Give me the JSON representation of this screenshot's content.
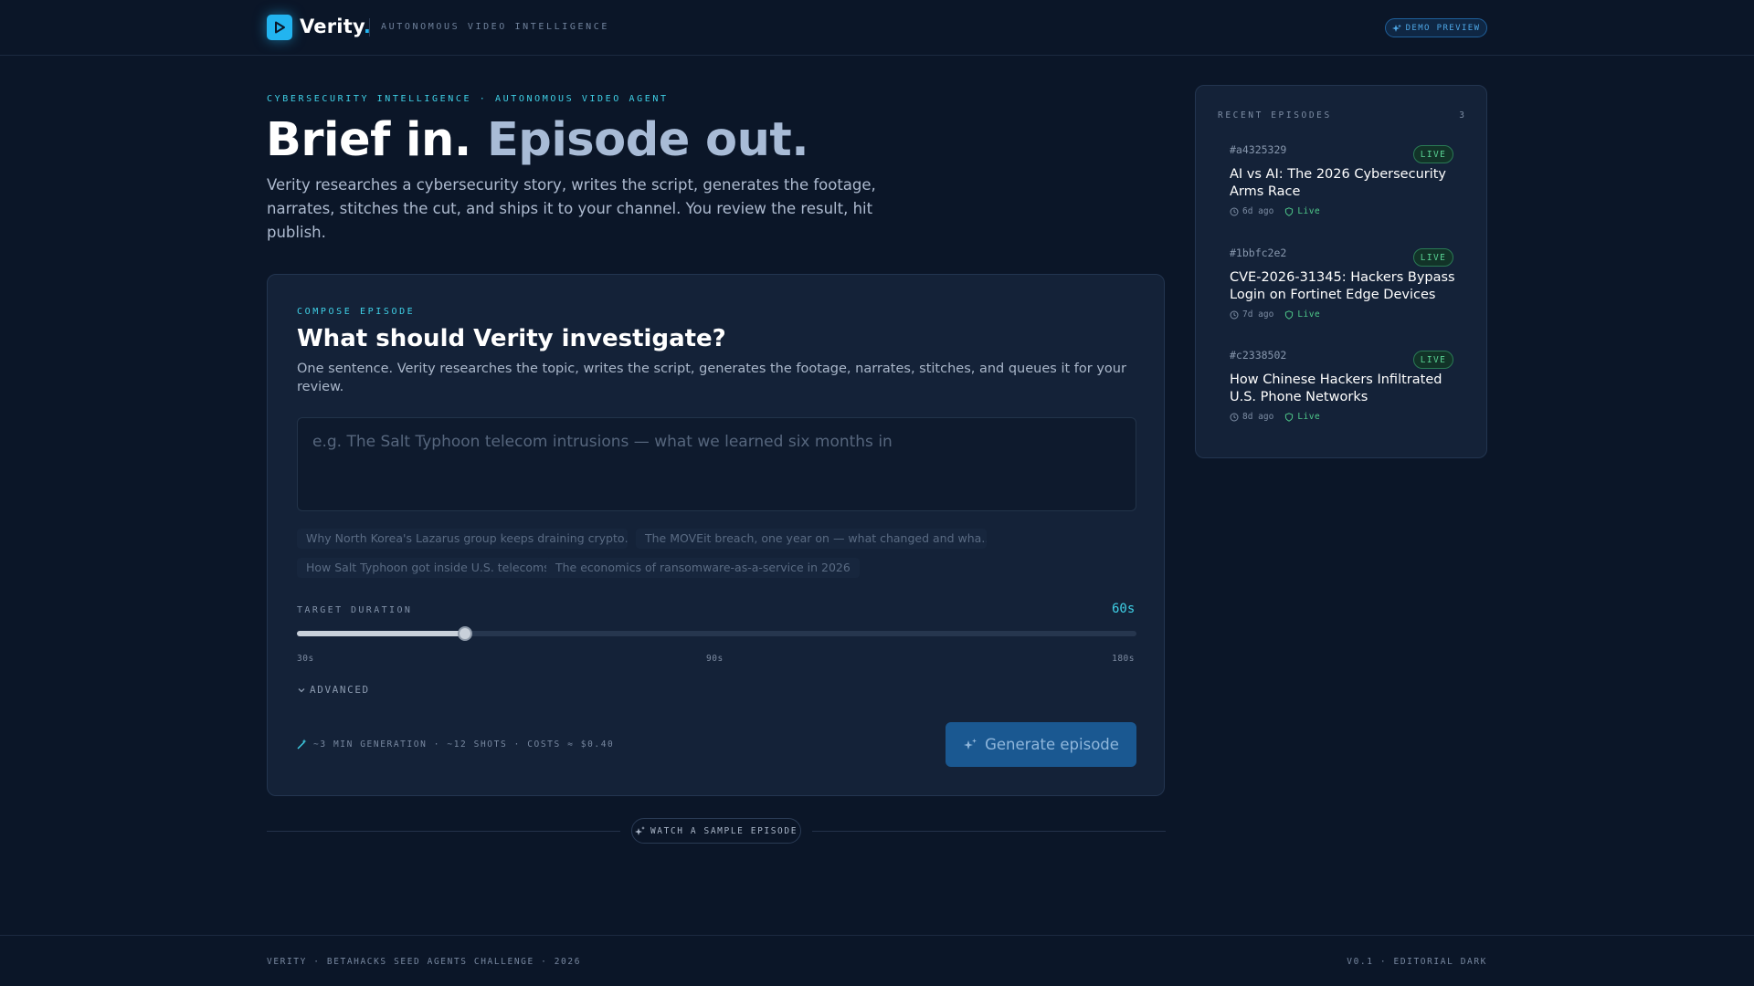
{
  "header": {
    "brand": "Verity",
    "brand_dot": ".",
    "tagline": "AUTONOMOUS VIDEO INTELLIGENCE",
    "demo_badge": "DEMO PREVIEW",
    "logo_icon": "play-icon"
  },
  "hero": {
    "eyebrow": "CYBERSECURITY INTELLIGENCE · AUTONOMOUS VIDEO AGENT",
    "title_main": "Brief in. ",
    "title_muted": "Episode out.",
    "subtitle": "Verity researches a cybersecurity story, writes the script, generates the footage, narrates, stitches the cut, and ships it to your channel. You review the result, hit publish."
  },
  "compose": {
    "eyebrow": "COMPOSE EPISODE",
    "title": "What should Verity investigate?",
    "subtitle": "One sentence. Verity researches the topic, writes the script, generates the footage, narrates, stitches, and queues it for your review.",
    "prompt_placeholder": "e.g. The Salt Typhoon telecom intrusions — what we learned six months in",
    "prompt_value": "",
    "suggestions": [
      "Why North Korea's Lazarus group keeps draining crypto…",
      "The MOVEit breach, one year on — what changed and wha…",
      "How Salt Typhoon got inside U.S. telecoms",
      "The economics of ransomware-as-a-service in 2026"
    ],
    "duration_label": "TARGET DURATION",
    "duration_value": "60s",
    "duration_seconds": 60,
    "duration_min": 30,
    "duration_max": 180,
    "ticks": [
      "30s",
      "90s",
      "180s"
    ],
    "advanced_label": "ADVANCED",
    "meta": "~3 MIN GENERATION · ~12 SHOTS · COSTS ≈ $0.40",
    "generate_label": "Generate episode"
  },
  "sample": {
    "label": "WATCH A SAMPLE EPISODE"
  },
  "recent": {
    "heading": "RECENT EPISODES",
    "count": "3",
    "episodes": [
      {
        "id": "#a4325329",
        "status": "LIVE",
        "title": "AI vs AI: The 2026 Cybersecurity Arms Race",
        "age": "6d ago",
        "state": "Live"
      },
      {
        "id": "#1bbfc2e2",
        "status": "LIVE",
        "title": "CVE-2026-31345: Hackers Bypass Login on Fortinet Edge Devices",
        "age": "7d ago",
        "state": "Live"
      },
      {
        "id": "#c2338502",
        "status": "LIVE",
        "title": "How Chinese Hackers Infiltrated U.S. Phone Networks",
        "age": "8d ago",
        "state": "Live"
      }
    ]
  },
  "footer": {
    "left": "VERITY · BETAHACKS SEED AGENTS CHALLENGE · 2026",
    "right": "V0.1 · EDITORIAL DARK"
  },
  "colors": {
    "background": "#0b1628",
    "card": "#142238",
    "accent": "#3fd0e6",
    "brand_blue": "#22b4f0",
    "button": "#1a5891",
    "live_green": "#59d394"
  }
}
